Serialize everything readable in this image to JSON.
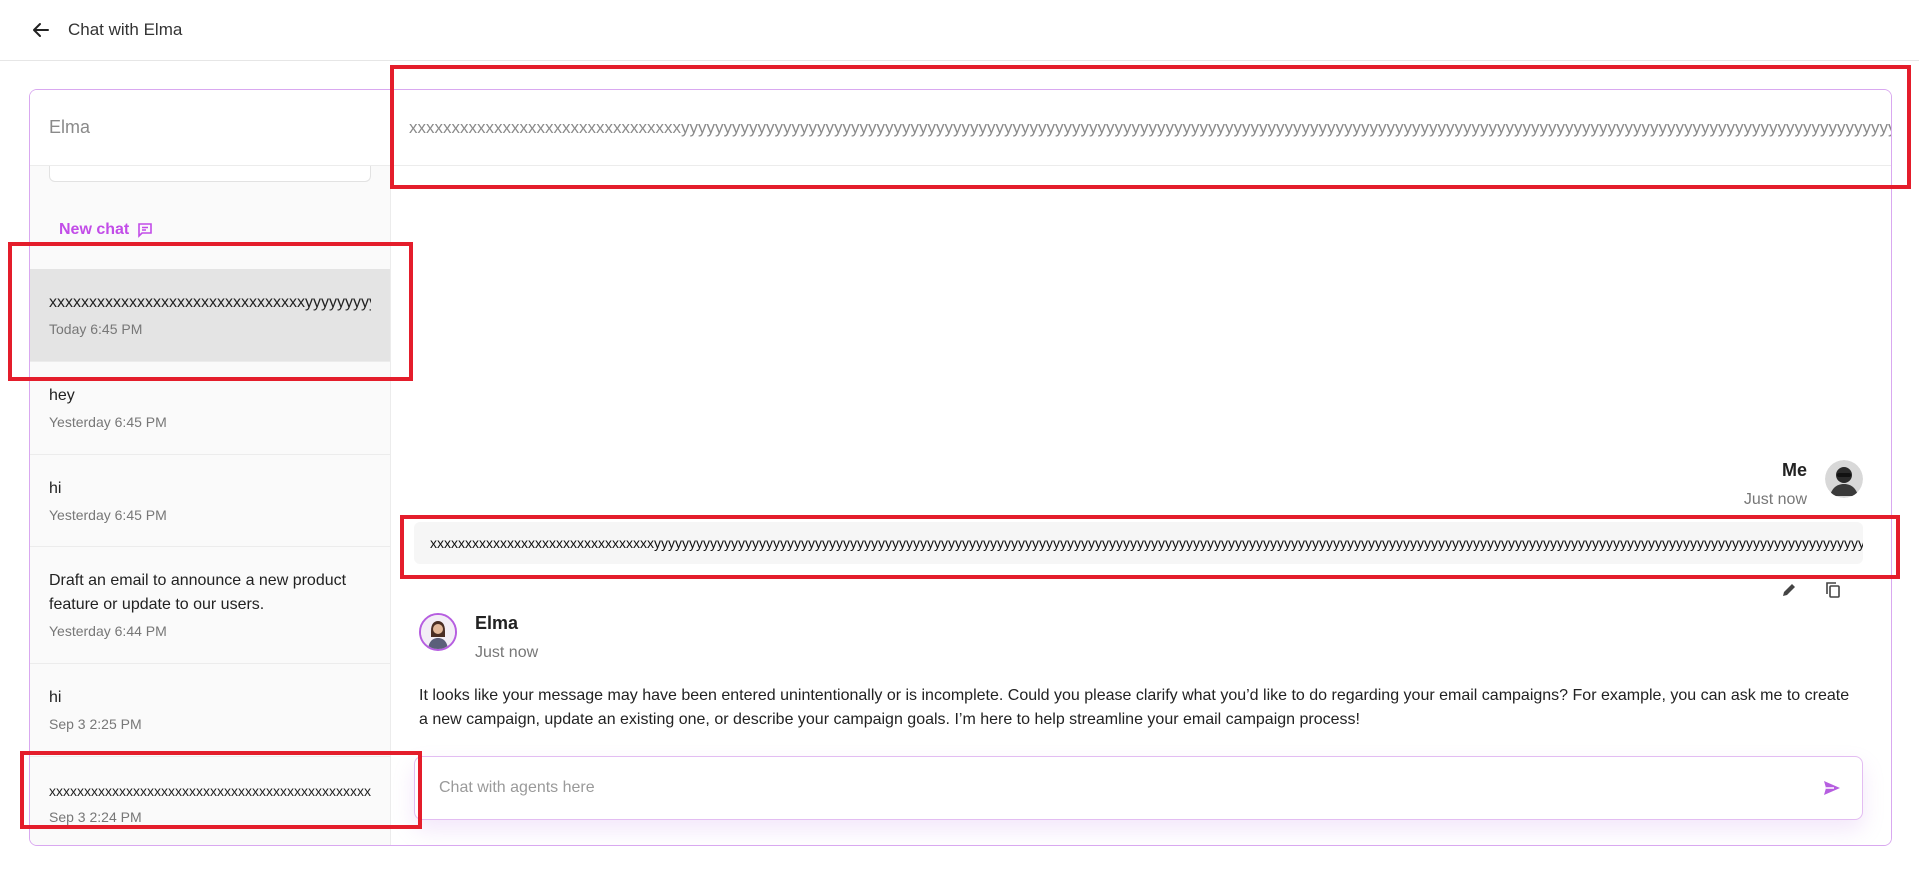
{
  "topbar": {
    "title": "Chat with Elma"
  },
  "sidebar": {
    "header": "Elma",
    "new_chat_label": "New chat",
    "chats": [
      {
        "title": "xxxxxxxxxxxxxxxxxxxxxxxxxxxxxxxxyyyyyyyyyyyyyyyyyyyyyyyyyyyyyyyyyyyyyyyyyyyy",
        "date": "Today 6:45 PM"
      },
      {
        "title": "hey",
        "date": "Yesterday 6:45 PM"
      },
      {
        "title": "hi",
        "date": "Yesterday 6:45 PM"
      },
      {
        "title": "Draft an email to announce a new product feature or update to our users.",
        "date": "Yesterday 6:44 PM"
      },
      {
        "title": "hi",
        "date": "Sep 3 2:25 PM"
      },
      {
        "title": "xxxxxxxxxxxxxxxxxxxxxxxxxxxxxxxxxxxxxxxxxxxxxxxxxxxxxxxx",
        "date": "Sep 3 2:24 PM"
      }
    ]
  },
  "conversation": {
    "header": "xxxxxxxxxxxxxxxxxxxxxxxxxxxxxxxxyyyyyyyyyyyyyyyyyyyyyyyyyyyyyyyyyyyyyyyyyyyyyyyyyyyyyyyyyyyyyyyyyyyyyyyyyyyyyyyyyyyyyyyyyyyyyyyyyyyyyyyyyyyyyyyyyyyyyyyyyyyyyyyyyyyyyyyyyyyyyyyyyyyyyyyyyyyyyyyyyyyyyyyyyyyy",
    "me": {
      "name": "Me",
      "time": "Just now",
      "message": "xxxxxxxxxxxxxxxxxxxxxxxxxxxxxxxxyyyyyyyyyyyyyyyyyyyyyyyyyyyyyyyyyyyyyyyyyyyyyyyyyyyyyyyyyyyyyyyyyyyyyyyyyyyyyyyyyyyyyyyyyyyyyyyyyyyyyyyyyyyyyyyyyyyyyyyyyyyyyyyyyyyyyyyyyyyyyyyyyyyyyyyyyyyyyyyyyyyyyyyyyyyyyyyy"
    },
    "elma": {
      "name": "Elma",
      "time": "Just now",
      "message": "It looks like your message may have been entered unintentionally or is incomplete. Could you please clarify what you’d like to do regarding your email campaigns? For example, you can ask me to create a new campaign, update an existing one, or describe your campaign goals. I’m here to help streamline your email campaign process!"
    },
    "composer": {
      "placeholder": "Chat with agents here",
      "value": ""
    }
  },
  "colors": {
    "accent": "#c24ce8",
    "highlight": "#e41d2b",
    "active_chat_bg": "#e4e4e4"
  },
  "icons": {
    "back": "arrow-left-icon",
    "new_chat": "chat-bubble-icon",
    "edit": "pencil-icon",
    "copy": "copy-icon",
    "send": "send-icon"
  }
}
